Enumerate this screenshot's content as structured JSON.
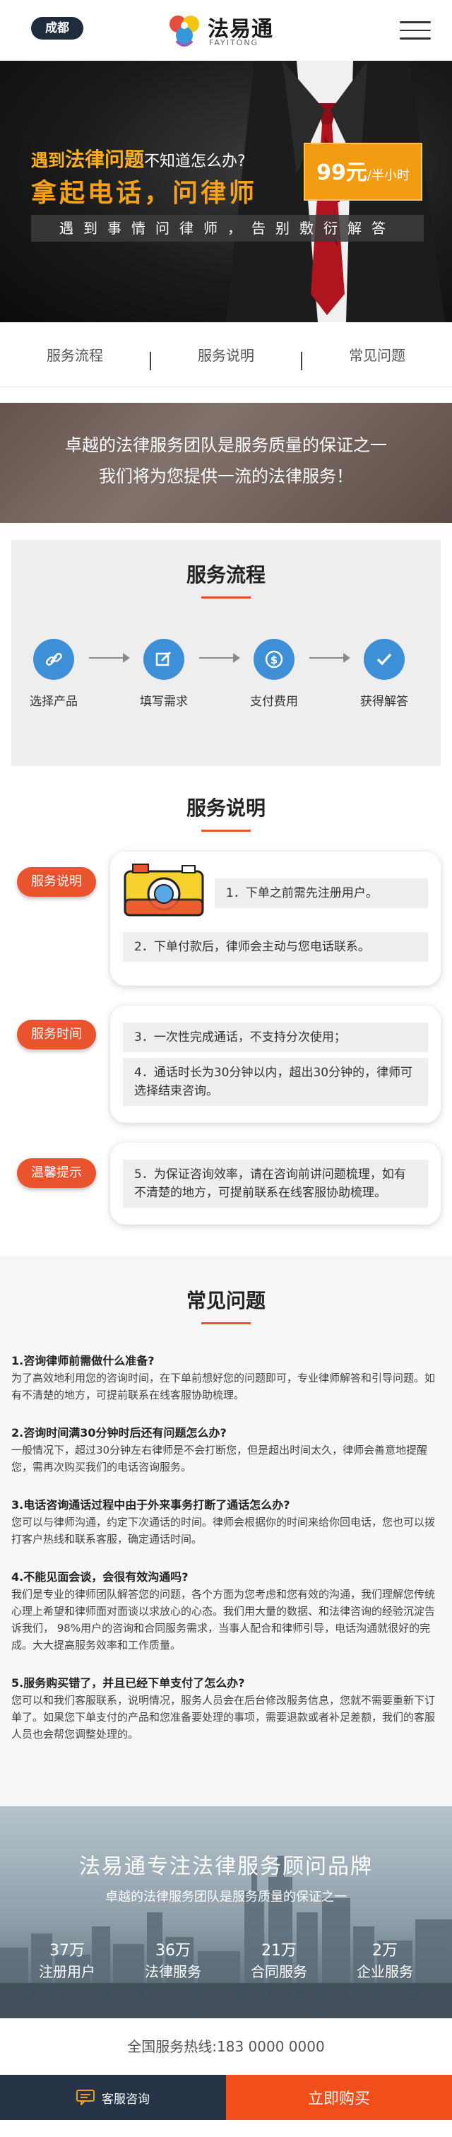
{
  "header": {
    "city": "成都",
    "logo_cn": "法易通",
    "logo_en": "FAYITONG"
  },
  "hero": {
    "line1_pre": "遇到",
    "line1_hl": "法律问题",
    "line1_rest": "不知道怎么办?",
    "line2": "拿起电话，问律师",
    "price": "99元",
    "price_unit": "/半小时",
    "sub": "遇到事情问律师，告别敷衍解答"
  },
  "tabs": [
    {
      "label": "服务流程"
    },
    {
      "label": "服务说明"
    },
    {
      "label": "常见问题"
    }
  ],
  "banner": {
    "line1": "卓越的法律服务团队是服务质量的保证之一",
    "line2": "我们将为您提供一流的法律服务！"
  },
  "flow": {
    "title": "服务流程",
    "steps": [
      {
        "label": "选择产品",
        "icon": "link-icon"
      },
      {
        "label": "填写需求",
        "icon": "edit-icon"
      },
      {
        "label": "支付费用",
        "icon": "dollar-icon"
      },
      {
        "label": "获得解答",
        "icon": "check-icon"
      }
    ]
  },
  "service": {
    "title": "服务说明",
    "rows": [
      {
        "tag": "服务说明",
        "items": [
          "1．下单之前需先注册用户。",
          "2．下单付款后，律师会主动与您电话联系。"
        ]
      },
      {
        "tag": "服务时间",
        "items": [
          "3．一次性完成通话，不支持分次使用；",
          "4．通话时长为30分钟以内，超出30分钟的，律师可选择结束咨询。"
        ]
      },
      {
        "tag": "温馨提示",
        "items": [
          "5．为保证咨询效率，请在咨询前讲问题梳理，如有不清楚的地方，可提前联系在线客服协助梳理。"
        ]
      }
    ]
  },
  "faq": {
    "title": "常见问题",
    "items": [
      {
        "q": "1.咨询律师前需做什么准备?",
        "a": "为了高效地利用您的咨询时间，在下单前想好您的问题即可，专业律师解答和引导问题。如有不清楚的地方，可提前联系在线客服协助梳理。"
      },
      {
        "q": "2.咨询时间满30分钟时后还有问题怎么办?",
        "a": "一般情况下，超过30分钟左右律师是不会打断您，但是超出时间太久，律师会善意地提醒您，需再次购买我们的电话咨询服务。"
      },
      {
        "q": "3.电话咨询通话过程中由于外来事务打断了通话怎么办?",
        "a": "您可以与律师沟通，约定下次通话的时间。律师会根据你的时间来给你回电话，您也可以拨打客户热线和联系客服，确定通话时间。"
      },
      {
        "q": "4.不能见面会谈，会很有效沟通吗?",
        "a": "我们是专业的律师团队解答您的问题，各个方面为您考虑和您有效的沟通，我们理解您传统心理上希望和律师面对面谈以求放心的心态。我们用大量的数据、和法律咨询的经验沉淀告诉我们， 98%用户的咨询和合同服务需求，当事人配合和律师引导，电话沟通就很好的完成。大大提高服务效率和工作质量。"
      },
      {
        "q": "5.服务购买错了，并且已经下单支付了怎么办?",
        "a": "您可以和我们客服联系，说明情况，服务人员会在后台修改服务信息，您就不需要重新下订单了。如果您下单支付的产品和您准备要处理的事项，需要退款或者补足差额，我们的客服人员也会帮您调整处理的。"
      }
    ]
  },
  "brand": {
    "title": "法易通专注法律服务顾问品牌",
    "sub": "卓越的法律服务团队是服务质量的保证之一",
    "stats": [
      {
        "num": "37万",
        "label": "注册用户"
      },
      {
        "num": "36万",
        "label": "法律服务"
      },
      {
        "num": "21万",
        "label": "合同服务"
      },
      {
        "num": "2万",
        "label": "企业服务"
      }
    ]
  },
  "hotline": "全国服务热线:183 0000 0000",
  "bottom": {
    "consult": "客服咨询",
    "buy": "立即购买"
  },
  "colors": {
    "accent": "#e9532d",
    "blue": "#3d8fd6",
    "orange": "#f39c12",
    "navy": "#263447"
  }
}
